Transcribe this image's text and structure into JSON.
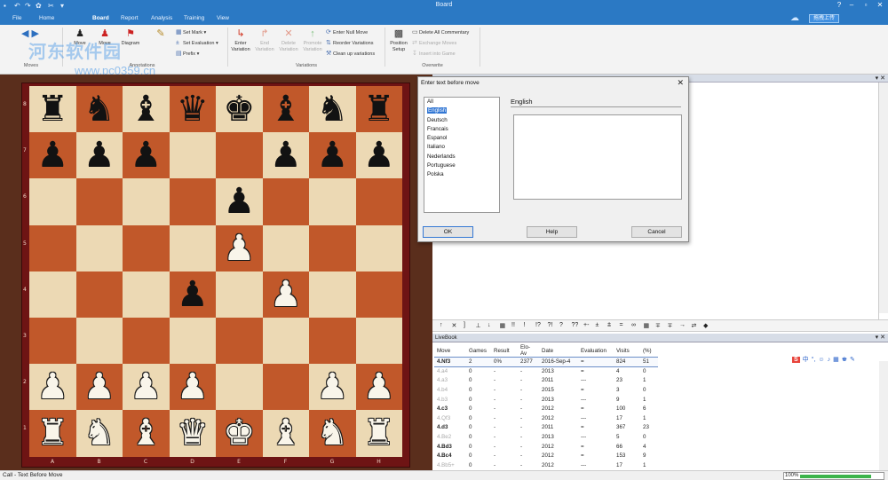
{
  "window": {
    "title": "Board",
    "watermark_line1": "河东软件园",
    "watermark_line2": "www.pc0359.cn"
  },
  "tabs": [
    "File",
    "Home",
    "Board",
    "Report",
    "Analysis",
    "Training",
    "View"
  ],
  "cloud_button": "拖拽上传",
  "ribbon": {
    "moves_group": "Moves",
    "annotations_group": "Annotations",
    "variations_group": "Variations",
    "overwrite_group": "Overwrite",
    "move1": "Move",
    "move2": "Move",
    "diagram": "Diagram",
    "set_mark": "Set Mark",
    "set_evaluation": "Set Evaluation",
    "prefix": "Prefix",
    "enter_variation": "Enter Variation",
    "end_variation": "End Variation",
    "delete_variation": "Delete Variation",
    "promote_variation": "Promote Variation",
    "enter_null_move": "Enter Null Move",
    "reorder_variations": "Reorder Variations",
    "clean_up_variations": "Clean up variations",
    "position_setup": "Position Setup",
    "delete_all_commentary": "Delete All Commentary",
    "exchange_moves": "Exchange Moves",
    "insert_into_game": "Insert into Game"
  },
  "board": {
    "ranks": [
      "8",
      "7",
      "6",
      "5",
      "4",
      "3",
      "2",
      "1"
    ],
    "files": [
      "A",
      "B",
      "C",
      "D",
      "E",
      "F",
      "G",
      "H"
    ],
    "rows": [
      [
        "bR",
        "bN",
        "bB",
        "bQ",
        "bK",
        "bB",
        "bN",
        "bR"
      ],
      [
        "bP",
        "bP",
        "bP",
        "",
        "",
        "bP",
        "bP",
        "bP"
      ],
      [
        "",
        "",
        "",
        "",
        "bP",
        "",
        "",
        ""
      ],
      [
        "",
        "",
        "",
        "",
        "wP",
        "",
        "",
        ""
      ],
      [
        "",
        "",
        "",
        "bP",
        "",
        "wP",
        "",
        ""
      ],
      [
        "",
        "",
        "",
        "",
        "",
        "",
        "",
        ""
      ],
      [
        "wP",
        "wP",
        "wP",
        "wP",
        "",
        "",
        "wP",
        "wP"
      ],
      [
        "wR",
        "wN",
        "wB",
        "wQ",
        "wK",
        "wB",
        "wN",
        "wR"
      ]
    ]
  },
  "dialog": {
    "title": "Enter text before move",
    "languages": [
      "All",
      "English",
      "Deutsch",
      "Francais",
      "Espanol",
      "Italiano",
      "Nederlands",
      "Portuguese",
      "Polska"
    ],
    "selected_language": "English",
    "label": "English",
    "ok": "OK",
    "help": "Help",
    "cancel": "Cancel"
  },
  "symbols": [
    "↑",
    "✕",
    "]",
    "⊥",
    "↓",
    "▦",
    "!!",
    "!",
    "!?",
    "?!",
    "?",
    "??",
    "+-",
    "±",
    "⩲",
    "=",
    "∞",
    "▦",
    "∓",
    "∓",
    "→",
    "⇄",
    "◆"
  ],
  "livebook": {
    "title": "LiveBook",
    "columns": [
      "Move",
      "Games",
      "Result",
      "Elo-Av",
      "Date",
      "Evaluation",
      "Visits",
      "(%)"
    ],
    "rows": [
      {
        "move": "4.Nf3",
        "games": "2",
        "result": "0%",
        "elo": "2377",
        "date": "2016-Sep-4",
        "eval": "=",
        "visits": "824",
        "pct": "51",
        "style": "sel"
      },
      {
        "move": "4.a4",
        "games": "0",
        "result": "-",
        "elo": "-",
        "date": "2013",
        "eval": "=",
        "visits": "4",
        "pct": "0",
        "style": "gray"
      },
      {
        "move": "4.a3",
        "games": "0",
        "result": "-",
        "elo": "-",
        "date": "2011",
        "eval": "---",
        "visits": "23",
        "pct": "1",
        "style": "gray"
      },
      {
        "move": "4.b4",
        "games": "0",
        "result": "-",
        "elo": "-",
        "date": "2015",
        "eval": "=",
        "visits": "3",
        "pct": "0",
        "style": "gray"
      },
      {
        "move": "4.b3",
        "games": "0",
        "result": "-",
        "elo": "-",
        "date": "2013",
        "eval": "---",
        "visits": "9",
        "pct": "1",
        "style": "gray"
      },
      {
        "move": "4.c3",
        "games": "0",
        "result": "-",
        "elo": "-",
        "date": "2012",
        "eval": "=",
        "visits": "100",
        "pct": "6",
        "style": "bold"
      },
      {
        "move": "4.Qf3",
        "games": "0",
        "result": "-",
        "elo": "-",
        "date": "2012",
        "eval": "---",
        "visits": "17",
        "pct": "1",
        "style": "gray"
      },
      {
        "move": "4.d3",
        "games": "0",
        "result": "-",
        "elo": "-",
        "date": "2011",
        "eval": "=",
        "visits": "367",
        "pct": "23",
        "style": "bold"
      },
      {
        "move": "4.Be2",
        "games": "0",
        "result": "-",
        "elo": "-",
        "date": "2013",
        "eval": "---",
        "visits": "5",
        "pct": "0",
        "style": "gray"
      },
      {
        "move": "4.Bd3",
        "games": "0",
        "result": "-",
        "elo": "-",
        "date": "2012",
        "eval": "=",
        "visits": "66",
        "pct": "4",
        "style": "bold"
      },
      {
        "move": "4.Bc4",
        "games": "0",
        "result": "-",
        "elo": "-",
        "date": "2012",
        "eval": "=",
        "visits": "153",
        "pct": "9",
        "style": "bold"
      },
      {
        "move": "4.Bb5+",
        "games": "0",
        "result": "-",
        "elo": "-",
        "date": "2012",
        "eval": "---",
        "visits": "17",
        "pct": "1",
        "style": "gray"
      }
    ]
  },
  "status": {
    "text": "Call - Text Before Move",
    "zoom": "100%",
    "progress": 0.85
  }
}
